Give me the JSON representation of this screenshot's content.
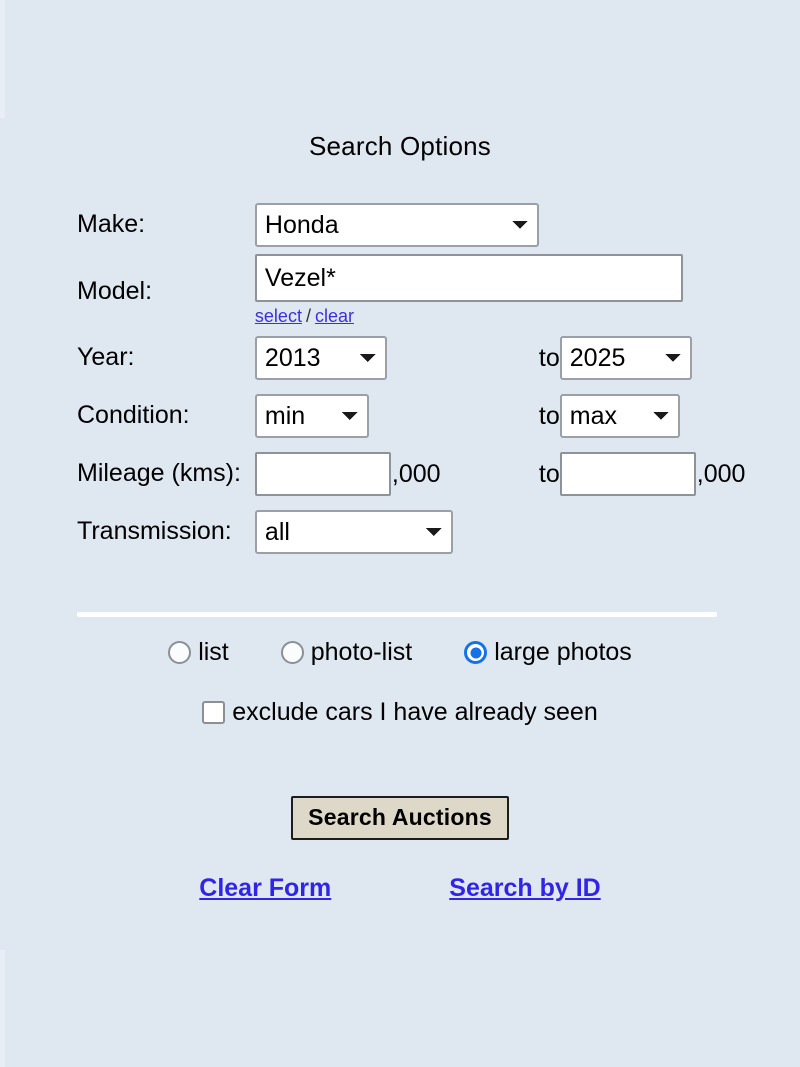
{
  "page": {
    "title": "Search Options",
    "background_color": "#dfe7f0"
  },
  "form": {
    "rows": [
      {
        "label": "Make:"
      },
      {
        "label": "Model:"
      },
      {
        "label": "Year:"
      },
      {
        "label": "Condition:"
      },
      {
        "label": "Mileage (kms):"
      },
      {
        "label": "Transmission:"
      }
    ],
    "make": {
      "label": "Make:",
      "value": "Honda",
      "options": [
        "Honda"
      ]
    },
    "model": {
      "label": "Model:",
      "value": "Vezel*",
      "placeholder": "",
      "select_link": "select",
      "separator": "/",
      "clear_link": "clear"
    },
    "year": {
      "label": "Year:",
      "from": "2013",
      "to_word": "to",
      "to": "2025",
      "from_options": [
        "2013"
      ],
      "to_options": [
        "2025"
      ]
    },
    "condition": {
      "label": "Condition:",
      "from": "min",
      "to_word": "to",
      "to": "max",
      "from_options": [
        "min"
      ],
      "to_options": [
        "max"
      ]
    },
    "mileage": {
      "label": "Mileage (kms):",
      "from_value": "",
      "from_placeholder": "",
      "from_suffix": ",000",
      "to_word": "to",
      "to_value": "",
      "to_placeholder": "",
      "to_suffix": ",000"
    },
    "transmission": {
      "label": "Transmission:",
      "value": "all",
      "options": [
        "all"
      ]
    }
  },
  "view_options": {
    "radios": [
      {
        "label": "list",
        "checked": false
      },
      {
        "label": "photo-list",
        "checked": false
      },
      {
        "label": "large photos",
        "checked": true
      }
    ],
    "checkbox": {
      "label": "exclude cars I have already seen",
      "checked": false
    },
    "selected_accent_color": "#1472e8"
  },
  "actions": {
    "submit_label": "Search Auctions",
    "clear_form_label": "Clear Form",
    "search_by_id_label": "Search by ID",
    "link_color": "#2f24e8",
    "button_color": "#ded8c8"
  }
}
